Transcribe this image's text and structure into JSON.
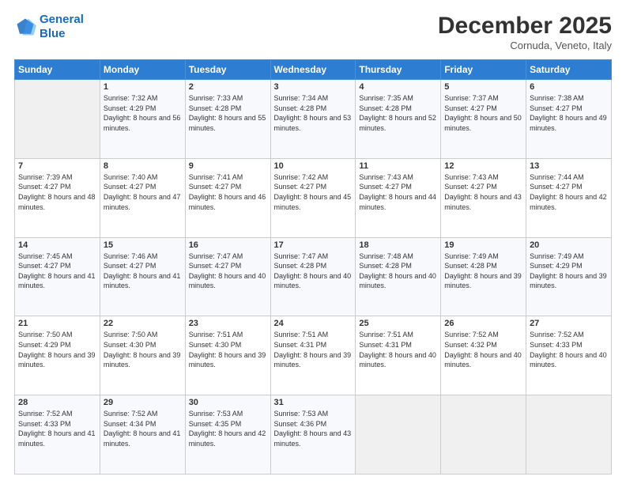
{
  "header": {
    "logo_line1": "General",
    "logo_line2": "Blue",
    "month_title": "December 2025",
    "location": "Cornuda, Veneto, Italy"
  },
  "weekdays": [
    "Sunday",
    "Monday",
    "Tuesday",
    "Wednesday",
    "Thursday",
    "Friday",
    "Saturday"
  ],
  "weeks": [
    [
      {
        "day": "",
        "sunrise": "",
        "sunset": "",
        "daylight": ""
      },
      {
        "day": "1",
        "sunrise": "Sunrise: 7:32 AM",
        "sunset": "Sunset: 4:29 PM",
        "daylight": "Daylight: 8 hours and 56 minutes."
      },
      {
        "day": "2",
        "sunrise": "Sunrise: 7:33 AM",
        "sunset": "Sunset: 4:28 PM",
        "daylight": "Daylight: 8 hours and 55 minutes."
      },
      {
        "day": "3",
        "sunrise": "Sunrise: 7:34 AM",
        "sunset": "Sunset: 4:28 PM",
        "daylight": "Daylight: 8 hours and 53 minutes."
      },
      {
        "day": "4",
        "sunrise": "Sunrise: 7:35 AM",
        "sunset": "Sunset: 4:28 PM",
        "daylight": "Daylight: 8 hours and 52 minutes."
      },
      {
        "day": "5",
        "sunrise": "Sunrise: 7:37 AM",
        "sunset": "Sunset: 4:27 PM",
        "daylight": "Daylight: 8 hours and 50 minutes."
      },
      {
        "day": "6",
        "sunrise": "Sunrise: 7:38 AM",
        "sunset": "Sunset: 4:27 PM",
        "daylight": "Daylight: 8 hours and 49 minutes."
      }
    ],
    [
      {
        "day": "7",
        "sunrise": "Sunrise: 7:39 AM",
        "sunset": "Sunset: 4:27 PM",
        "daylight": "Daylight: 8 hours and 48 minutes."
      },
      {
        "day": "8",
        "sunrise": "Sunrise: 7:40 AM",
        "sunset": "Sunset: 4:27 PM",
        "daylight": "Daylight: 8 hours and 47 minutes."
      },
      {
        "day": "9",
        "sunrise": "Sunrise: 7:41 AM",
        "sunset": "Sunset: 4:27 PM",
        "daylight": "Daylight: 8 hours and 46 minutes."
      },
      {
        "day": "10",
        "sunrise": "Sunrise: 7:42 AM",
        "sunset": "Sunset: 4:27 PM",
        "daylight": "Daylight: 8 hours and 45 minutes."
      },
      {
        "day": "11",
        "sunrise": "Sunrise: 7:43 AM",
        "sunset": "Sunset: 4:27 PM",
        "daylight": "Daylight: 8 hours and 44 minutes."
      },
      {
        "day": "12",
        "sunrise": "Sunrise: 7:43 AM",
        "sunset": "Sunset: 4:27 PM",
        "daylight": "Daylight: 8 hours and 43 minutes."
      },
      {
        "day": "13",
        "sunrise": "Sunrise: 7:44 AM",
        "sunset": "Sunset: 4:27 PM",
        "daylight": "Daylight: 8 hours and 42 minutes."
      }
    ],
    [
      {
        "day": "14",
        "sunrise": "Sunrise: 7:45 AM",
        "sunset": "Sunset: 4:27 PM",
        "daylight": "Daylight: 8 hours and 41 minutes."
      },
      {
        "day": "15",
        "sunrise": "Sunrise: 7:46 AM",
        "sunset": "Sunset: 4:27 PM",
        "daylight": "Daylight: 8 hours and 41 minutes."
      },
      {
        "day": "16",
        "sunrise": "Sunrise: 7:47 AM",
        "sunset": "Sunset: 4:27 PM",
        "daylight": "Daylight: 8 hours and 40 minutes."
      },
      {
        "day": "17",
        "sunrise": "Sunrise: 7:47 AM",
        "sunset": "Sunset: 4:28 PM",
        "daylight": "Daylight: 8 hours and 40 minutes."
      },
      {
        "day": "18",
        "sunrise": "Sunrise: 7:48 AM",
        "sunset": "Sunset: 4:28 PM",
        "daylight": "Daylight: 8 hours and 40 minutes."
      },
      {
        "day": "19",
        "sunrise": "Sunrise: 7:49 AM",
        "sunset": "Sunset: 4:28 PM",
        "daylight": "Daylight: 8 hours and 39 minutes."
      },
      {
        "day": "20",
        "sunrise": "Sunrise: 7:49 AM",
        "sunset": "Sunset: 4:29 PM",
        "daylight": "Daylight: 8 hours and 39 minutes."
      }
    ],
    [
      {
        "day": "21",
        "sunrise": "Sunrise: 7:50 AM",
        "sunset": "Sunset: 4:29 PM",
        "daylight": "Daylight: 8 hours and 39 minutes."
      },
      {
        "day": "22",
        "sunrise": "Sunrise: 7:50 AM",
        "sunset": "Sunset: 4:30 PM",
        "daylight": "Daylight: 8 hours and 39 minutes."
      },
      {
        "day": "23",
        "sunrise": "Sunrise: 7:51 AM",
        "sunset": "Sunset: 4:30 PM",
        "daylight": "Daylight: 8 hours and 39 minutes."
      },
      {
        "day": "24",
        "sunrise": "Sunrise: 7:51 AM",
        "sunset": "Sunset: 4:31 PM",
        "daylight": "Daylight: 8 hours and 39 minutes."
      },
      {
        "day": "25",
        "sunrise": "Sunrise: 7:51 AM",
        "sunset": "Sunset: 4:31 PM",
        "daylight": "Daylight: 8 hours and 40 minutes."
      },
      {
        "day": "26",
        "sunrise": "Sunrise: 7:52 AM",
        "sunset": "Sunset: 4:32 PM",
        "daylight": "Daylight: 8 hours and 40 minutes."
      },
      {
        "day": "27",
        "sunrise": "Sunrise: 7:52 AM",
        "sunset": "Sunset: 4:33 PM",
        "daylight": "Daylight: 8 hours and 40 minutes."
      }
    ],
    [
      {
        "day": "28",
        "sunrise": "Sunrise: 7:52 AM",
        "sunset": "Sunset: 4:33 PM",
        "daylight": "Daylight: 8 hours and 41 minutes."
      },
      {
        "day": "29",
        "sunrise": "Sunrise: 7:52 AM",
        "sunset": "Sunset: 4:34 PM",
        "daylight": "Daylight: 8 hours and 41 minutes."
      },
      {
        "day": "30",
        "sunrise": "Sunrise: 7:53 AM",
        "sunset": "Sunset: 4:35 PM",
        "daylight": "Daylight: 8 hours and 42 minutes."
      },
      {
        "day": "31",
        "sunrise": "Sunrise: 7:53 AM",
        "sunset": "Sunset: 4:36 PM",
        "daylight": "Daylight: 8 hours and 43 minutes."
      },
      {
        "day": "",
        "sunrise": "",
        "sunset": "",
        "daylight": ""
      },
      {
        "day": "",
        "sunrise": "",
        "sunset": "",
        "daylight": ""
      },
      {
        "day": "",
        "sunrise": "",
        "sunset": "",
        "daylight": ""
      }
    ]
  ]
}
